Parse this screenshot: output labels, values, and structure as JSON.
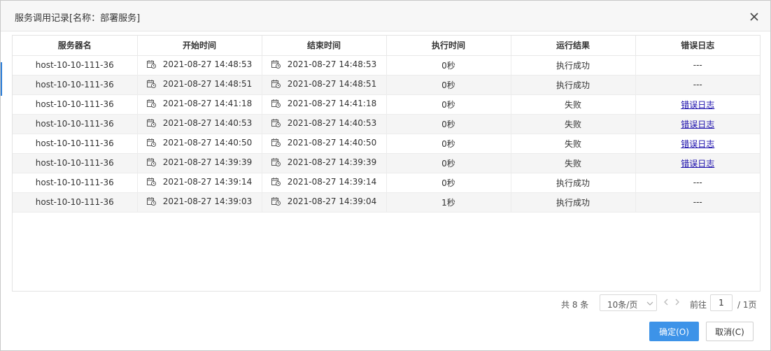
{
  "dialog": {
    "title": "服务调用记录[名称：部署服务]"
  },
  "table": {
    "headers": [
      "服务器名",
      "开始时间",
      "结束时间",
      "执行时间",
      "运行结果",
      "错误日志"
    ],
    "rows": [
      {
        "server": "host-10-10-111-36",
        "start": "2021-08-27 14:48:53",
        "end": "2021-08-27 14:48:53",
        "duration": "0秒",
        "result": "执行成功",
        "log": "---"
      },
      {
        "server": "host-10-10-111-36",
        "start": "2021-08-27 14:48:51",
        "end": "2021-08-27 14:48:51",
        "duration": "0秒",
        "result": "执行成功",
        "log": "---"
      },
      {
        "server": "host-10-10-111-36",
        "start": "2021-08-27 14:41:18",
        "end": "2021-08-27 14:41:18",
        "duration": "0秒",
        "result": "失败",
        "log": "错误日志"
      },
      {
        "server": "host-10-10-111-36",
        "start": "2021-08-27 14:40:53",
        "end": "2021-08-27 14:40:53",
        "duration": "0秒",
        "result": "失败",
        "log": "错误日志"
      },
      {
        "server": "host-10-10-111-36",
        "start": "2021-08-27 14:40:50",
        "end": "2021-08-27 14:40:50",
        "duration": "0秒",
        "result": "失败",
        "log": "错误日志"
      },
      {
        "server": "host-10-10-111-36",
        "start": "2021-08-27 14:39:39",
        "end": "2021-08-27 14:39:39",
        "duration": "0秒",
        "result": "失败",
        "log": "错误日志"
      },
      {
        "server": "host-10-10-111-36",
        "start": "2021-08-27 14:39:14",
        "end": "2021-08-27 14:39:14",
        "duration": "0秒",
        "result": "执行成功",
        "log": "---"
      },
      {
        "server": "host-10-10-111-36",
        "start": "2021-08-27 14:39:03",
        "end": "2021-08-27 14:39:04",
        "duration": "1秒",
        "result": "执行成功",
        "log": "---"
      }
    ]
  },
  "pagination": {
    "total_text": "共 8 条",
    "page_size": "10条/页",
    "goto_label": "前往",
    "current_page": "1",
    "total_pages_text": "/ 1页"
  },
  "footer": {
    "ok_label": "确定(O)",
    "cancel_label": "取消(C)"
  },
  "icons": {
    "close": "close-icon",
    "date_cell": "calendar-clock-icon",
    "select": "chevron-down-icon",
    "prev": "chevron-left-icon",
    "next": "chevron-right-icon"
  },
  "colors": {
    "primary": "#3d93e8",
    "link": "#1a0dab",
    "stripe": "#f5f5f5"
  }
}
